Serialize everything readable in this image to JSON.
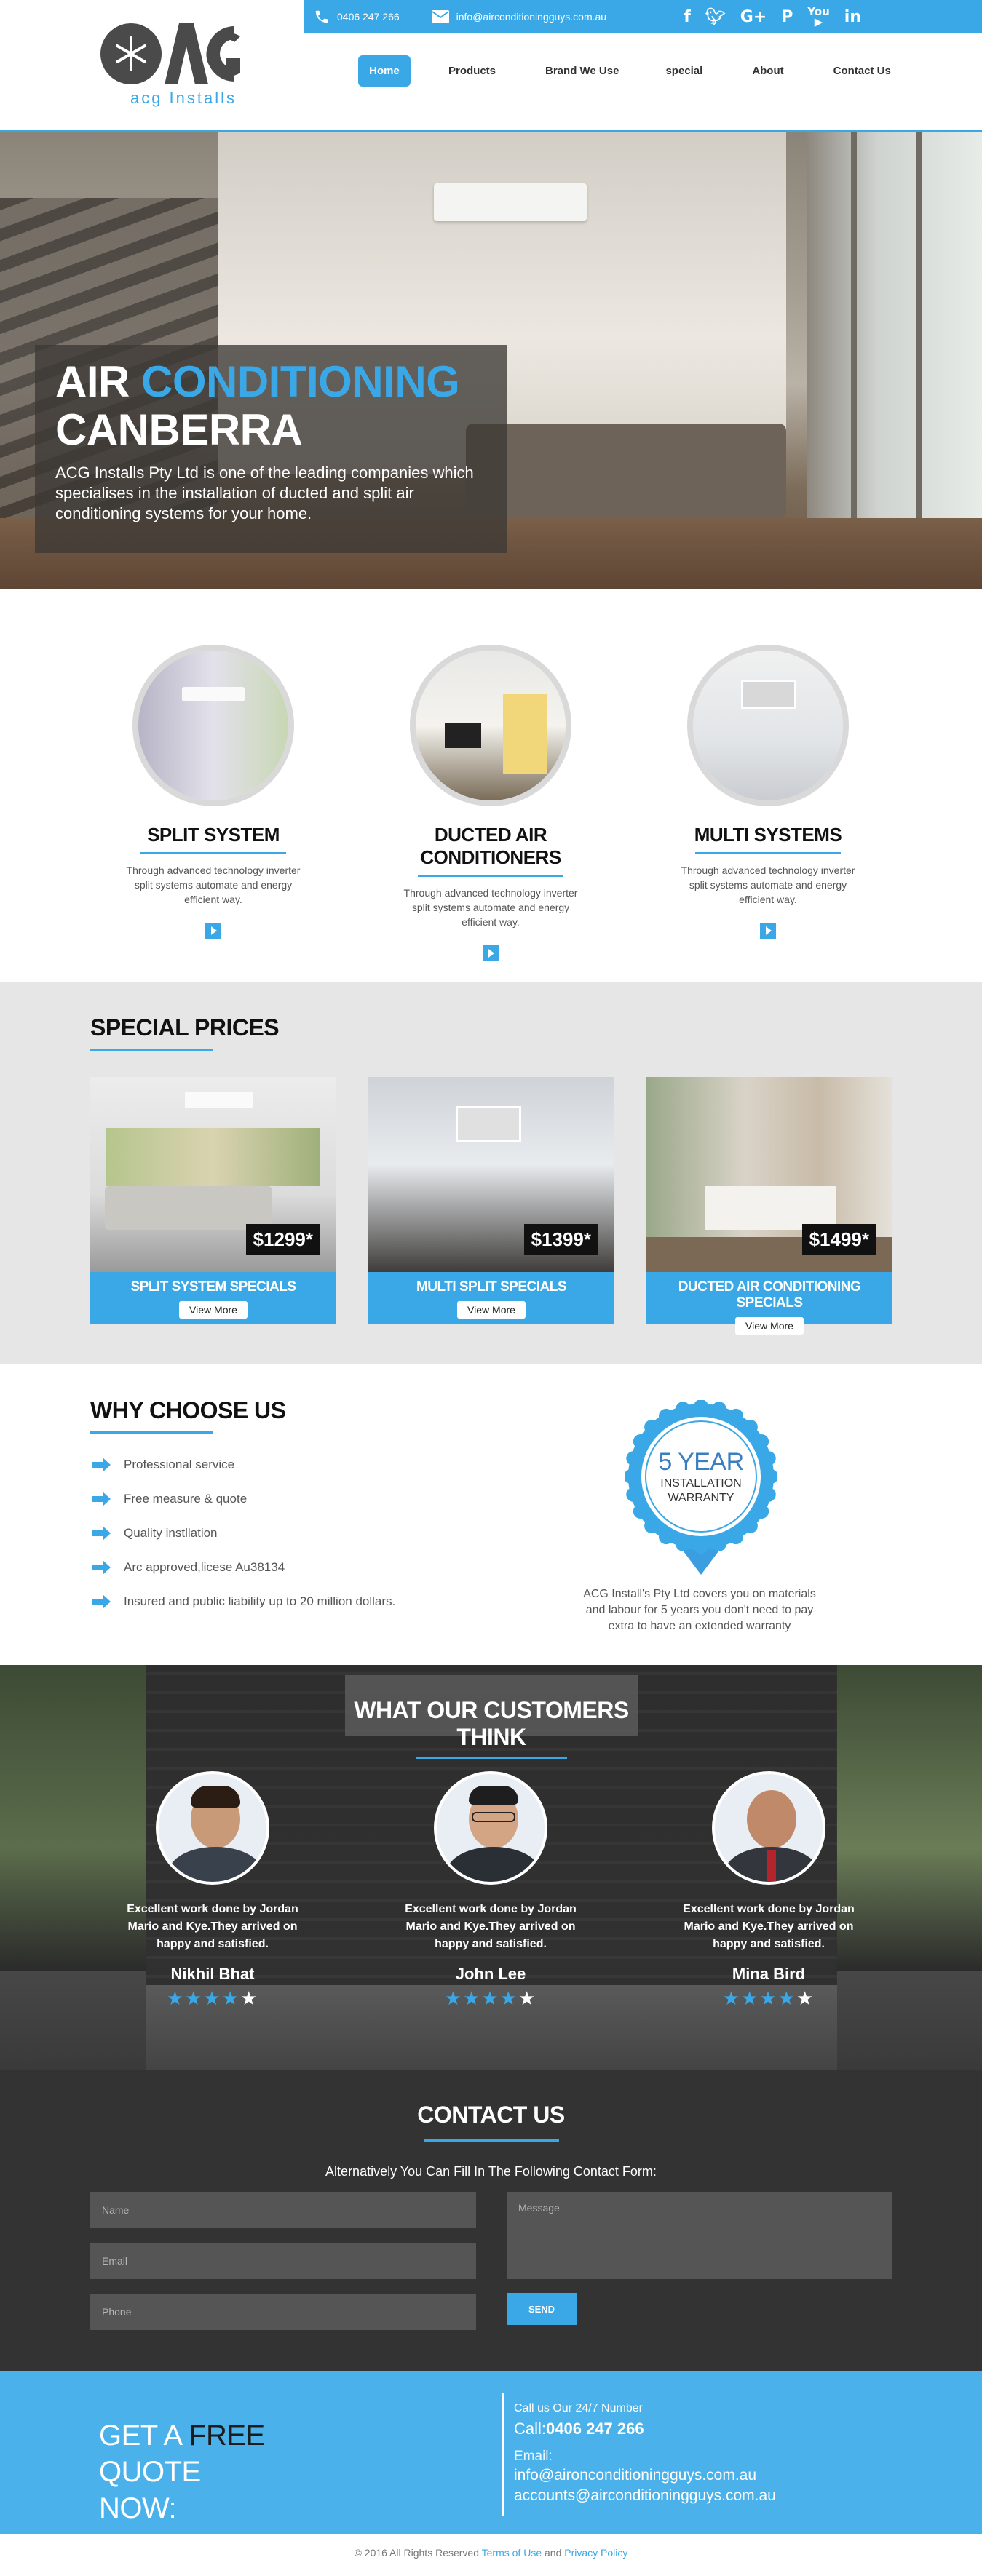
{
  "brand": {
    "logo_name": "acg-logo",
    "tagline": "acg Installs",
    "accent": "#3aa8e6"
  },
  "topbar": {
    "phone": "0406 247 266",
    "email": "info@airconditioningguys.com.au",
    "socials": [
      "facebook-icon",
      "twitter-icon",
      "google-plus-icon",
      "pinterest-icon",
      "youtube-icon",
      "linkedin-icon"
    ]
  },
  "nav": {
    "items": [
      "Home",
      "Products",
      "Brand We Use",
      "special",
      "About",
      "Contact Us"
    ],
    "active": "Home"
  },
  "hero": {
    "title_plain": "AIR",
    "title_blue": "CONDITIONING",
    "title_line2": "CANBERRA",
    "description": "ACG Installs Pty Ltd is one of the leading companies which specialises in the installation of ducted and split air conditioning systems for your home."
  },
  "services": [
    {
      "title": "SPLIT SYSTEM",
      "text": "Through advanced technology inverter split systems automate and energy efficient way."
    },
    {
      "title": "DUCTED AIR CONDITIONERS",
      "text": "Through advanced technology inverter split systems automate and energy efficient way."
    },
    {
      "title": "MULTI SYSTEMS",
      "text": "Through advanced technology inverter split systems automate and energy efficient way."
    }
  ],
  "specials": {
    "title": "SPECIAL PRICES",
    "items": [
      {
        "price": "$1299*",
        "label": "SPLIT SYSTEM SPECIALS",
        "button": "View More"
      },
      {
        "price": "$1399*",
        "label": "MULTI SPLIT SPECIALS",
        "button": "View More"
      },
      {
        "price": "$1499*",
        "label": "DUCTED AIR CONDITIONING SPECIALS",
        "button": "View More"
      }
    ]
  },
  "why": {
    "title": "WHY CHOOSE US",
    "items": [
      "Professional service",
      "Free measure & quote",
      "Quality instllation",
      "Arc approved,licese Au38134",
      "Insured and public liability up to 20 million dollars."
    ],
    "badge_big": "5 YEAR",
    "badge_line1": "INSTALLATION",
    "badge_line2": "WARRANTY",
    "warranty_text": "ACG Install's Pty Ltd covers you on materials and labour for 5 years you don't need to pay extra to have an extended warranty"
  },
  "testimonials": {
    "title": "WHAT OUR CUSTOMERS THINK",
    "items": [
      {
        "quote": "Excellent work done by Jordan Mario and Kye.They arrived on happy and satisfied.",
        "name": "Nikhil Bhat",
        "rating": 3.5
      },
      {
        "quote": "Excellent work done by Jordan Mario and Kye.They arrived on happy and satisfied.",
        "name": "John Lee",
        "rating": 3.5
      },
      {
        "quote": "Excellent work done by Jordan Mario and Kye.They arrived on happy and satisfied.",
        "name": "Mina Bird",
        "rating": 3.5
      }
    ]
  },
  "contact": {
    "title": "CONTACT US",
    "subtitle": "Alternatively You Can Fill In The Following Contact Form:",
    "name_placeholder": "Name",
    "email_placeholder": "Email",
    "phone_placeholder": "Phone",
    "message_placeholder": "Message",
    "send_label": "SEND"
  },
  "quote": {
    "line1_a": "GET A",
    "line1_free": "FREE",
    "line1_b": "QUOTE",
    "line2": "NOW:",
    "call_label": "Call us Our 24/7 Number",
    "call_prefix": "Call:",
    "call_number": "0406 247 266",
    "email_label": "Email:",
    "email1": "info@aironconditioningguys.com.au",
    "email2": "accounts@airconditioningguys.com.au"
  },
  "footer": {
    "copyright": "© 2016 All Rights Reserved",
    "terms": "Terms of Use",
    "and": "and",
    "privacy": "Privacy Policy"
  }
}
